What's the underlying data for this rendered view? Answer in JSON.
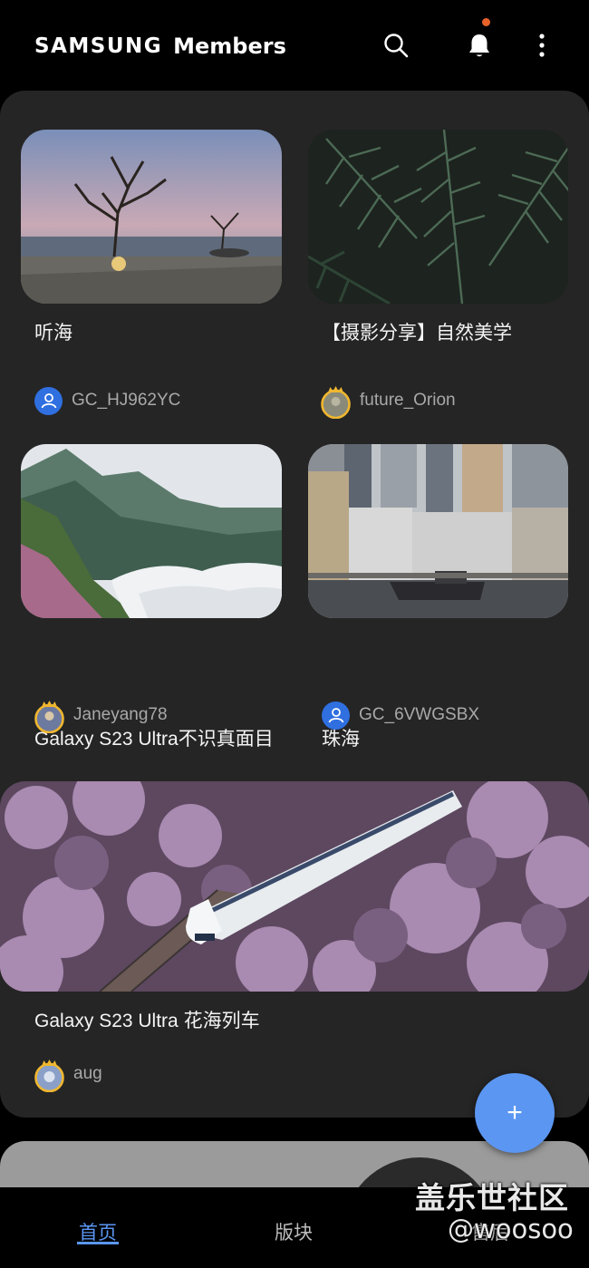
{
  "app": {
    "brand": "SAMSUNG",
    "title": "Members"
  },
  "header": {
    "icons": [
      "search-icon",
      "bell-icon",
      "more-vertical-icon"
    ],
    "notification_dot_color": "#e8622a"
  },
  "posts": [
    {
      "title": "听海",
      "author": "GC_HJ962YC",
      "avatar": "default-user"
    },
    {
      "title": "【摄影分享】自然美学",
      "author": "future_Orion",
      "avatar": "crown"
    },
    {
      "title": "Galaxy S23 Ultra不识真面目",
      "author": "Janeyang78",
      "avatar": "crown"
    },
    {
      "title": "珠海",
      "author": "GC_6VWGSBX",
      "avatar": "default-user"
    },
    {
      "title": "Galaxy S23 Ultra 花海列车",
      "author": "aug",
      "avatar": "crown"
    }
  ],
  "fab": {
    "icon": "plus-icon",
    "color": "#5b96f2"
  },
  "nav": {
    "home": "首页",
    "boards": "版块",
    "service": "售后"
  },
  "watermark": {
    "line1": "盖乐世社区",
    "line2": "@woosoo"
  },
  "colors": {
    "accent": "#5b96f2",
    "card_bg": "#252525",
    "page_bg": "#000000"
  }
}
